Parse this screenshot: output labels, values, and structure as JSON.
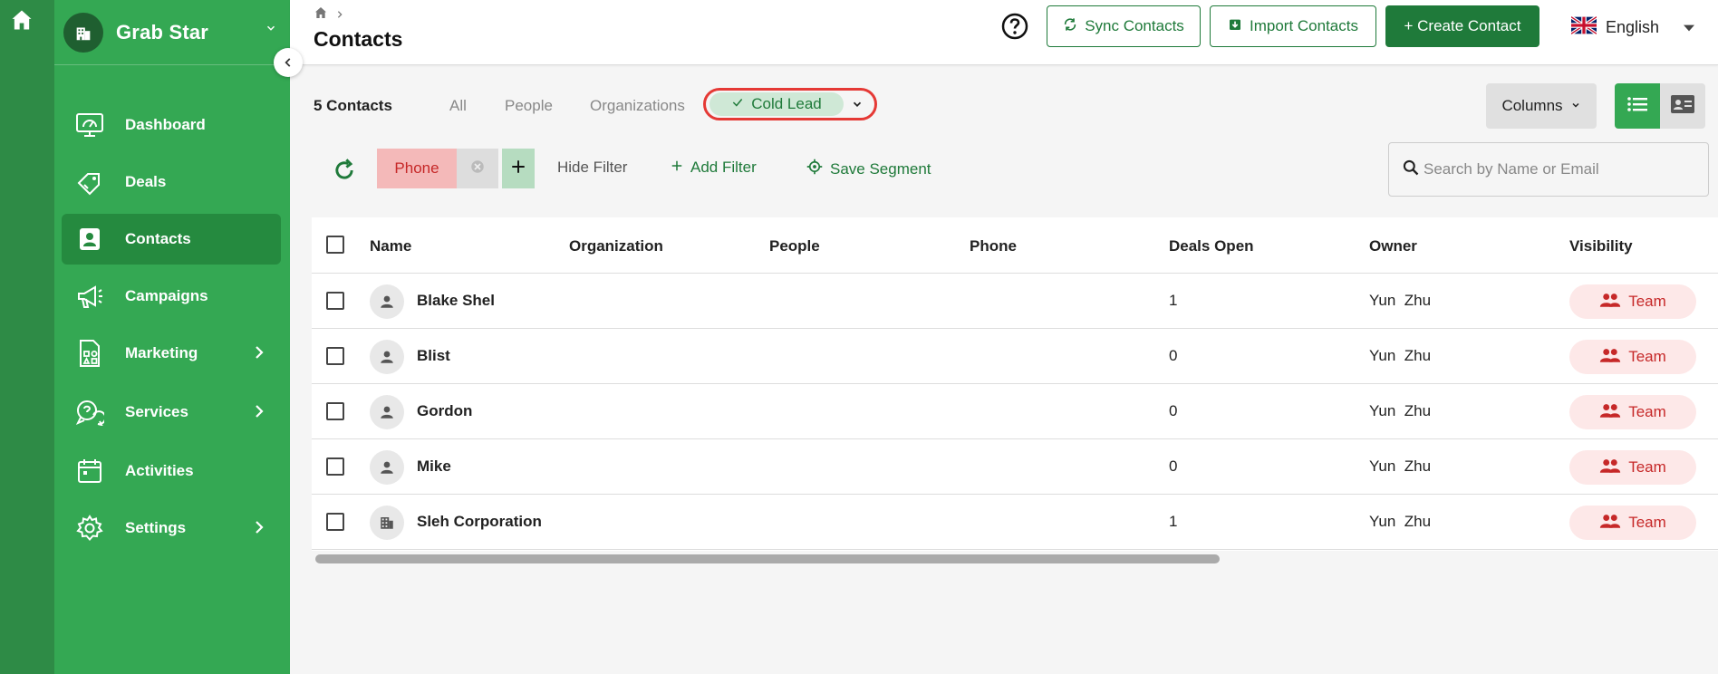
{
  "brand": {
    "name": "Grab Star"
  },
  "nav": [
    {
      "label": "Dashboard",
      "icon": "dashboard-icon",
      "active": false,
      "has_chevron": false
    },
    {
      "label": "Deals",
      "icon": "deals-icon",
      "active": false,
      "has_chevron": false
    },
    {
      "label": "Contacts",
      "icon": "contacts-icon",
      "active": true,
      "has_chevron": false
    },
    {
      "label": "Campaigns",
      "icon": "megaphone-icon",
      "active": false,
      "has_chevron": false
    },
    {
      "label": "Marketing",
      "icon": "marketing-icon",
      "active": false,
      "has_chevron": true
    },
    {
      "label": "Services",
      "icon": "services-icon",
      "active": false,
      "has_chevron": true
    },
    {
      "label": "Activities",
      "icon": "calendar-icon",
      "active": false,
      "has_chevron": false
    },
    {
      "label": "Settings",
      "icon": "gear-icon",
      "active": false,
      "has_chevron": true
    }
  ],
  "header": {
    "title": "Contacts",
    "sync_label": "Sync Contacts",
    "import_label": "Import Contacts",
    "create_label": "+ Create Contact",
    "language": "English"
  },
  "toolbar": {
    "count_label": "5 Contacts",
    "tabs": [
      "All",
      "People",
      "Organizations"
    ],
    "segment_label": "Cold Lead",
    "columns_label": "Columns"
  },
  "filters": {
    "chip_label": "Phone",
    "hide_label": "Hide Filter",
    "add_label": "Add Filter",
    "save_label": "Save Segment",
    "search_placeholder": "Search by Name or Email"
  },
  "table": {
    "columns": [
      "Name",
      "Organization",
      "People",
      "Phone",
      "Deals Open",
      "Owner",
      "Visibility"
    ],
    "rows": [
      {
        "name": "Blake Shel",
        "type": "person",
        "organization": "",
        "people": "",
        "phone": "",
        "deals_open": "1",
        "owner": "Yun  Zhu",
        "visibility": "Team"
      },
      {
        "name": "Blist",
        "type": "person",
        "organization": "",
        "people": "",
        "phone": "",
        "deals_open": "0",
        "owner": "Yun  Zhu",
        "visibility": "Team"
      },
      {
        "name": "Gordon",
        "type": "person",
        "organization": "",
        "people": "",
        "phone": "",
        "deals_open": "0",
        "owner": "Yun  Zhu",
        "visibility": "Team"
      },
      {
        "name": "Mike",
        "type": "person",
        "organization": "",
        "people": "",
        "phone": "",
        "deals_open": "0",
        "owner": "Yun  Zhu",
        "visibility": "Team"
      },
      {
        "name": "Sleh Corporation",
        "type": "organization",
        "organization": "",
        "people": "",
        "phone": "",
        "deals_open": "1",
        "owner": "Yun  Zhu",
        "visibility": "Team"
      }
    ]
  },
  "colors": {
    "sidebar": "#34a853",
    "rail": "#2e8b46",
    "primary": "#1f7a3a",
    "badge_bg": "#fde8e8",
    "badge_fg": "#c62828",
    "highlight_ring": "#e53935"
  }
}
